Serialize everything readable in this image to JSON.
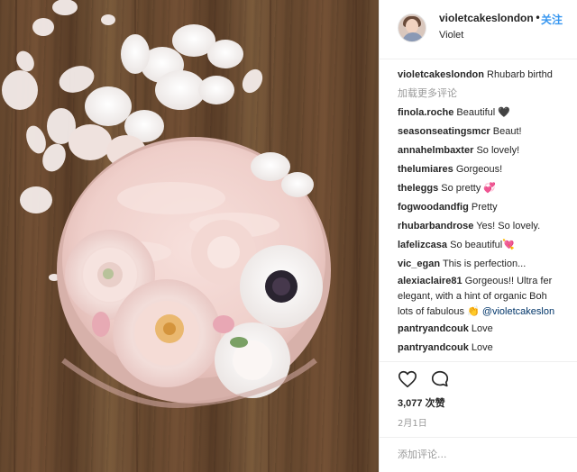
{
  "post": {
    "username": "violetcakeslondon",
    "separator": "•",
    "follow_label": "关注",
    "display_name": "Violet"
  },
  "caption": {
    "username": "violetcakeslondon",
    "text": "Rhubarb birthd"
  },
  "load_more_label": "加载更多评论",
  "comments": [
    {
      "user": "finola.roche",
      "text": "Beautiful 🖤"
    },
    {
      "user": "seasonseatingsmcr",
      "text": "Beaut!"
    },
    {
      "user": "annahelmbaxter",
      "text": "So lovely!"
    },
    {
      "user": "thelumiares",
      "text": "Gorgeous!"
    },
    {
      "user": "theleggs",
      "text": "So pretty 💞"
    },
    {
      "user": "fogwoodandfig",
      "text": "Pretty"
    },
    {
      "user": "rhubarbandrose",
      "text": "Yes! So lovely."
    },
    {
      "user": "lafelizcasa",
      "text": "So beautiful💘"
    },
    {
      "user": "vic_egan",
      "text": "This is perfection..."
    },
    {
      "user": "alexiaclaire81",
      "text": "Gorgeous!! Ultra fer",
      "line2": "elegant, with a hint of organic Boh",
      "line3_text": "lots of fabulous 👏",
      "mention": "@violetcakeslon"
    },
    {
      "user": "pantryandcouk",
      "text": "Love"
    },
    {
      "user": "pantryandcouk",
      "text": "Love"
    }
  ],
  "actions": {
    "like_icon": "heart-outline-icon",
    "comment_icon": "speech-bubble-icon",
    "likes_count": "3,077",
    "likes_label": "次赞",
    "date": "2月1日"
  },
  "add_comment": {
    "placeholder": "添加评论..."
  },
  "colors": {
    "link_blue": "#3897f0",
    "muted_gray": "#999999",
    "text": "#262626",
    "divider": "#efefef"
  }
}
